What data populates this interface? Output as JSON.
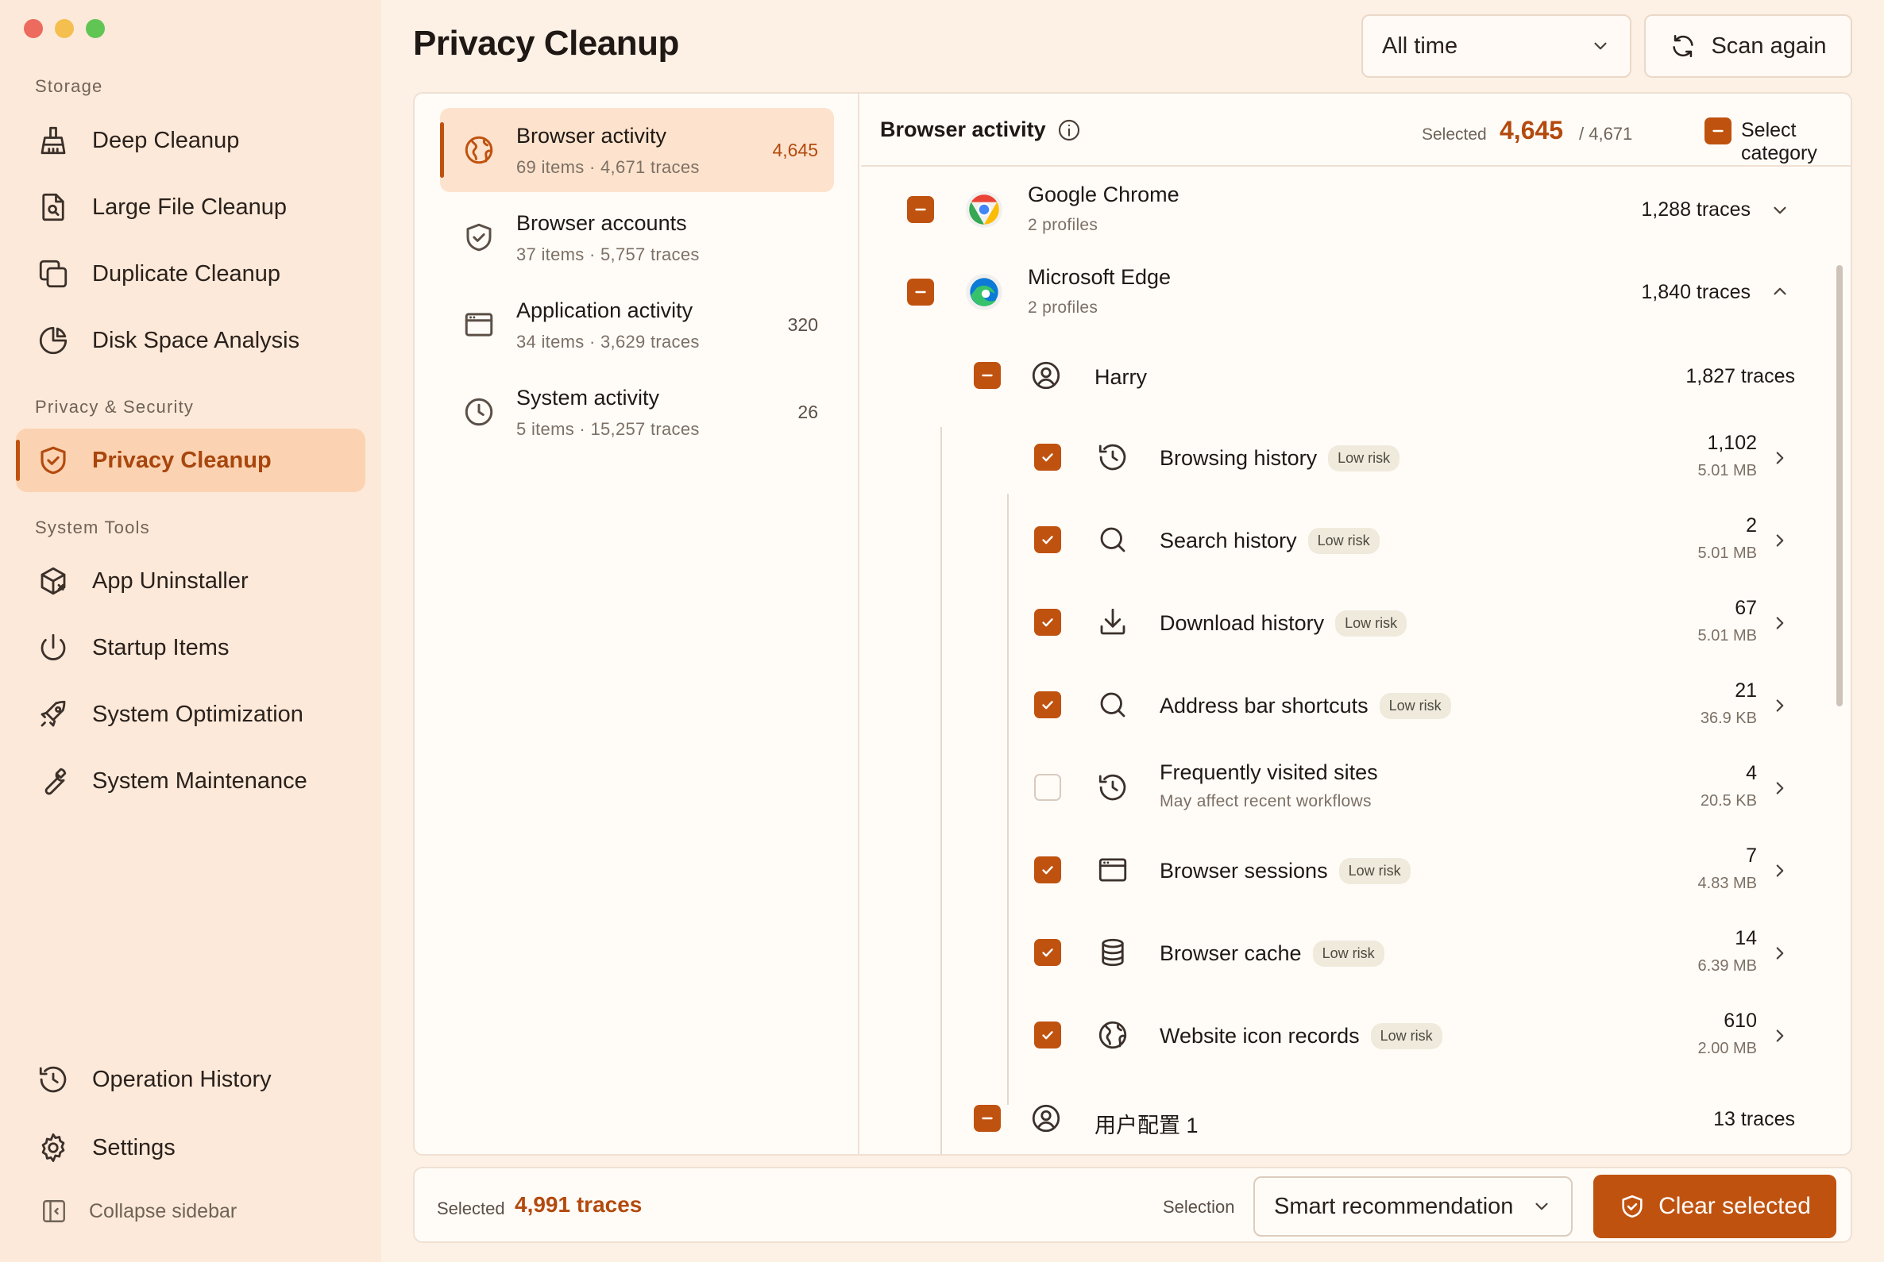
{
  "window": {
    "title": "Privacy Cleanup"
  },
  "sidebar": {
    "sections": [
      {
        "label": "Storage",
        "items": [
          {
            "label": "Deep Cleanup",
            "icon": "broom-icon"
          },
          {
            "label": "Large File Cleanup",
            "icon": "file-search-icon"
          },
          {
            "label": "Duplicate Cleanup",
            "icon": "copy-icon"
          },
          {
            "label": "Disk Space Analysis",
            "icon": "pie-chart-icon"
          }
        ]
      },
      {
        "label": "Privacy & Security",
        "items": [
          {
            "label": "Privacy Cleanup",
            "icon": "shield-icon",
            "active": true
          }
        ]
      },
      {
        "label": "System Tools",
        "items": [
          {
            "label": "App Uninstaller",
            "icon": "package-x-icon"
          },
          {
            "label": "Startup Items",
            "icon": "power-icon"
          },
          {
            "label": "System Optimization",
            "icon": "rocket-icon"
          },
          {
            "label": "System Maintenance",
            "icon": "wrench-icon"
          }
        ]
      }
    ],
    "bottom": [
      {
        "label": "Operation History",
        "icon": "history-icon"
      },
      {
        "label": "Settings",
        "icon": "gear-icon"
      }
    ],
    "collapse_label": "Collapse sidebar"
  },
  "header": {
    "title": "Privacy Cleanup",
    "time_range": "All time",
    "scan_label": "Scan again"
  },
  "categories": [
    {
      "name": "Browser activity",
      "meta": "69 items · 4,671 traces",
      "count": "4,645",
      "active": true,
      "icon": "globe-icon"
    },
    {
      "name": "Browser accounts",
      "meta": "37 items · 5,757 traces",
      "count": "",
      "icon": "shield-check-icon"
    },
    {
      "name": "Application activity",
      "meta": "34 items · 3,629 traces",
      "count": "320",
      "icon": "window-icon"
    },
    {
      "name": "System activity",
      "meta": "5 items · 15,257 traces",
      "count": "26",
      "icon": "clock-icon"
    }
  ],
  "detail": {
    "title": "Browser activity",
    "selected_label": "Selected",
    "selected_count": "4,645",
    "total": "/ 4,671",
    "select_category_label": "Select category",
    "browsers": [
      {
        "name": "Google Chrome",
        "sub": "2 profiles",
        "traces": "1,288 traces",
        "expanded": false
      },
      {
        "name": "Microsoft Edge",
        "sub": "2 profiles",
        "traces": "1,840 traces",
        "expanded": true
      }
    ],
    "profiles": [
      {
        "name": "Harry",
        "traces": "1,827 traces"
      },
      {
        "name": "用户配置 1",
        "traces": "13 traces"
      }
    ],
    "items": [
      {
        "name": "Browsing history",
        "risk": "Low risk",
        "count": "1,102",
        "size": "5.01 MB",
        "checked": true,
        "icon": "history-icon"
      },
      {
        "name": "Search history",
        "risk": "Low risk",
        "count": "2",
        "size": "5.01 MB",
        "checked": true,
        "icon": "search-icon"
      },
      {
        "name": "Download history",
        "risk": "Low risk",
        "count": "67",
        "size": "5.01 MB",
        "checked": true,
        "icon": "download-icon"
      },
      {
        "name": "Address bar shortcuts",
        "risk": "Low risk",
        "count": "21",
        "size": "36.9 KB",
        "checked": true,
        "icon": "search-icon"
      },
      {
        "name": "Frequently visited sites",
        "note": "May affect recent workflows",
        "count": "4",
        "size": "20.5 KB",
        "checked": false,
        "icon": "history-icon"
      },
      {
        "name": "Browser sessions",
        "risk": "Low risk",
        "count": "7",
        "size": "4.83 MB",
        "checked": true,
        "icon": "window-icon"
      },
      {
        "name": "Browser cache",
        "risk": "Low risk",
        "count": "14",
        "size": "6.39 MB",
        "checked": true,
        "icon": "database-icon"
      },
      {
        "name": "Website icon records",
        "risk": "Low risk",
        "count": "610",
        "size": "2.00 MB",
        "checked": true,
        "icon": "globe-icon"
      }
    ]
  },
  "footer": {
    "selected_label": "Selected",
    "selected_count": "4,991 traces",
    "selection_label": "Selection",
    "selection_value": "Smart recommendation",
    "clear_label": "Clear selected"
  },
  "colors": {
    "accent": "#c0520f",
    "sidebar_bg": "#fde9d9",
    "active_bg": "#fbd3b2"
  }
}
